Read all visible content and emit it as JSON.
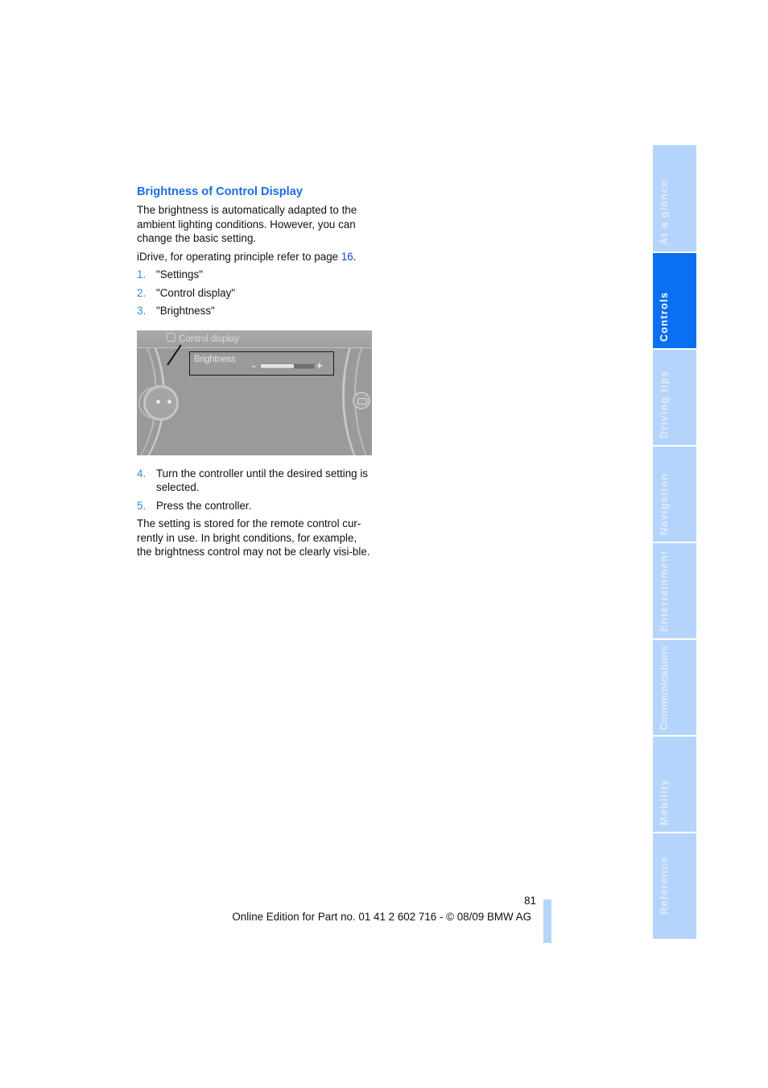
{
  "section": {
    "heading": "Brightness of Control Display",
    "intro": "The brightness is automatically adapted to the ambient lighting conditions. However, you can change the basic setting.",
    "idrive_ref_text": "iDrive, for operating principle refer to page ",
    "idrive_ref_page": "16",
    "idrive_ref_end": ".",
    "steps_before": [
      {
        "num": "1.",
        "text": "\"Settings\""
      },
      {
        "num": "2.",
        "text": "\"Control display\""
      },
      {
        "num": "3.",
        "text": "\"Brightness\""
      }
    ],
    "steps_after": [
      {
        "num": "4.",
        "text": "Turn the controller until the desired setting is selected."
      },
      {
        "num": "5.",
        "text": "Press the controller."
      }
    ],
    "closing": "The setting is stored for the remote control cur-rently in use. In bright conditions, for example, the brightness control may not be clearly visi-ble."
  },
  "screen": {
    "title": "Control display",
    "title_icon": "settings-gear-icon",
    "menu_item": "Brightness",
    "slider_minus": "-",
    "slider_plus": "+",
    "slider_level_percent": 62
  },
  "tabs": [
    {
      "label": "At a glance",
      "active": false
    },
    {
      "label": "Controls",
      "active": true
    },
    {
      "label": "Driving tips",
      "active": false
    },
    {
      "label": "Navigation",
      "active": false
    },
    {
      "label": "Entertainment",
      "active": false
    },
    {
      "label": "Communications",
      "active": false
    },
    {
      "label": "Mobility",
      "active": false
    },
    {
      "label": "Reference",
      "active": false
    }
  ],
  "footer": {
    "page_number": "81",
    "edition": "Online Edition for Part no. 01 41 2 602 716 - © 08/09 BMW AG"
  },
  "colors": {
    "heading": "#1a6fe0",
    "step_number": "#2a8ae8",
    "link": "#1a3fe0",
    "tab_inactive": "#b5d4fb",
    "tab_active": "#0a6ff0"
  }
}
